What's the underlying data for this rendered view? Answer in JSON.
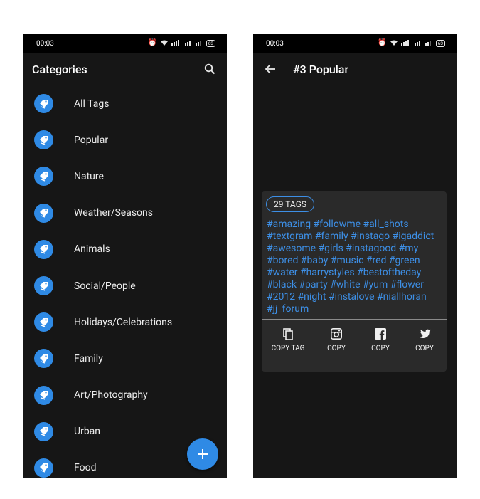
{
  "left": {
    "status": {
      "time": "00:03",
      "battery": "63"
    },
    "title": "Categories",
    "categories": [
      "All Tags",
      "Popular",
      "Nature",
      "Weather/Seasons",
      "Animals",
      "Social/People",
      "Holidays/Celebrations",
      "Family",
      "Art/Photography",
      "Urban",
      "Food"
    ],
    "fab_label": "+"
  },
  "right": {
    "status": {
      "time": "00:03",
      "battery": "63"
    },
    "title": "#3 Popular",
    "tag_count": "29 TAGS",
    "tag_lines": [
      "#amazing #followme #all_shots",
      "#textgram #family #instago #igaddict",
      "#awesome #girls #instagood #my",
      "#bored #baby #music #red #green",
      "#water #harrystyles #bestoftheday",
      "#black #party #white #yum #flower",
      "#2012 #night #instalove #niallhoran",
      "#jj_forum"
    ],
    "actions": [
      {
        "label": "COPY TAG",
        "icon": "copy-icon"
      },
      {
        "label": "COPY",
        "icon": "instagram-icon"
      },
      {
        "label": "COPY",
        "icon": "facebook-icon"
      },
      {
        "label": "COPY",
        "icon": "twitter-icon"
      }
    ]
  },
  "colors": {
    "accent": "#2f8ae5",
    "background": "#161616",
    "card": "#2a2a2a"
  }
}
